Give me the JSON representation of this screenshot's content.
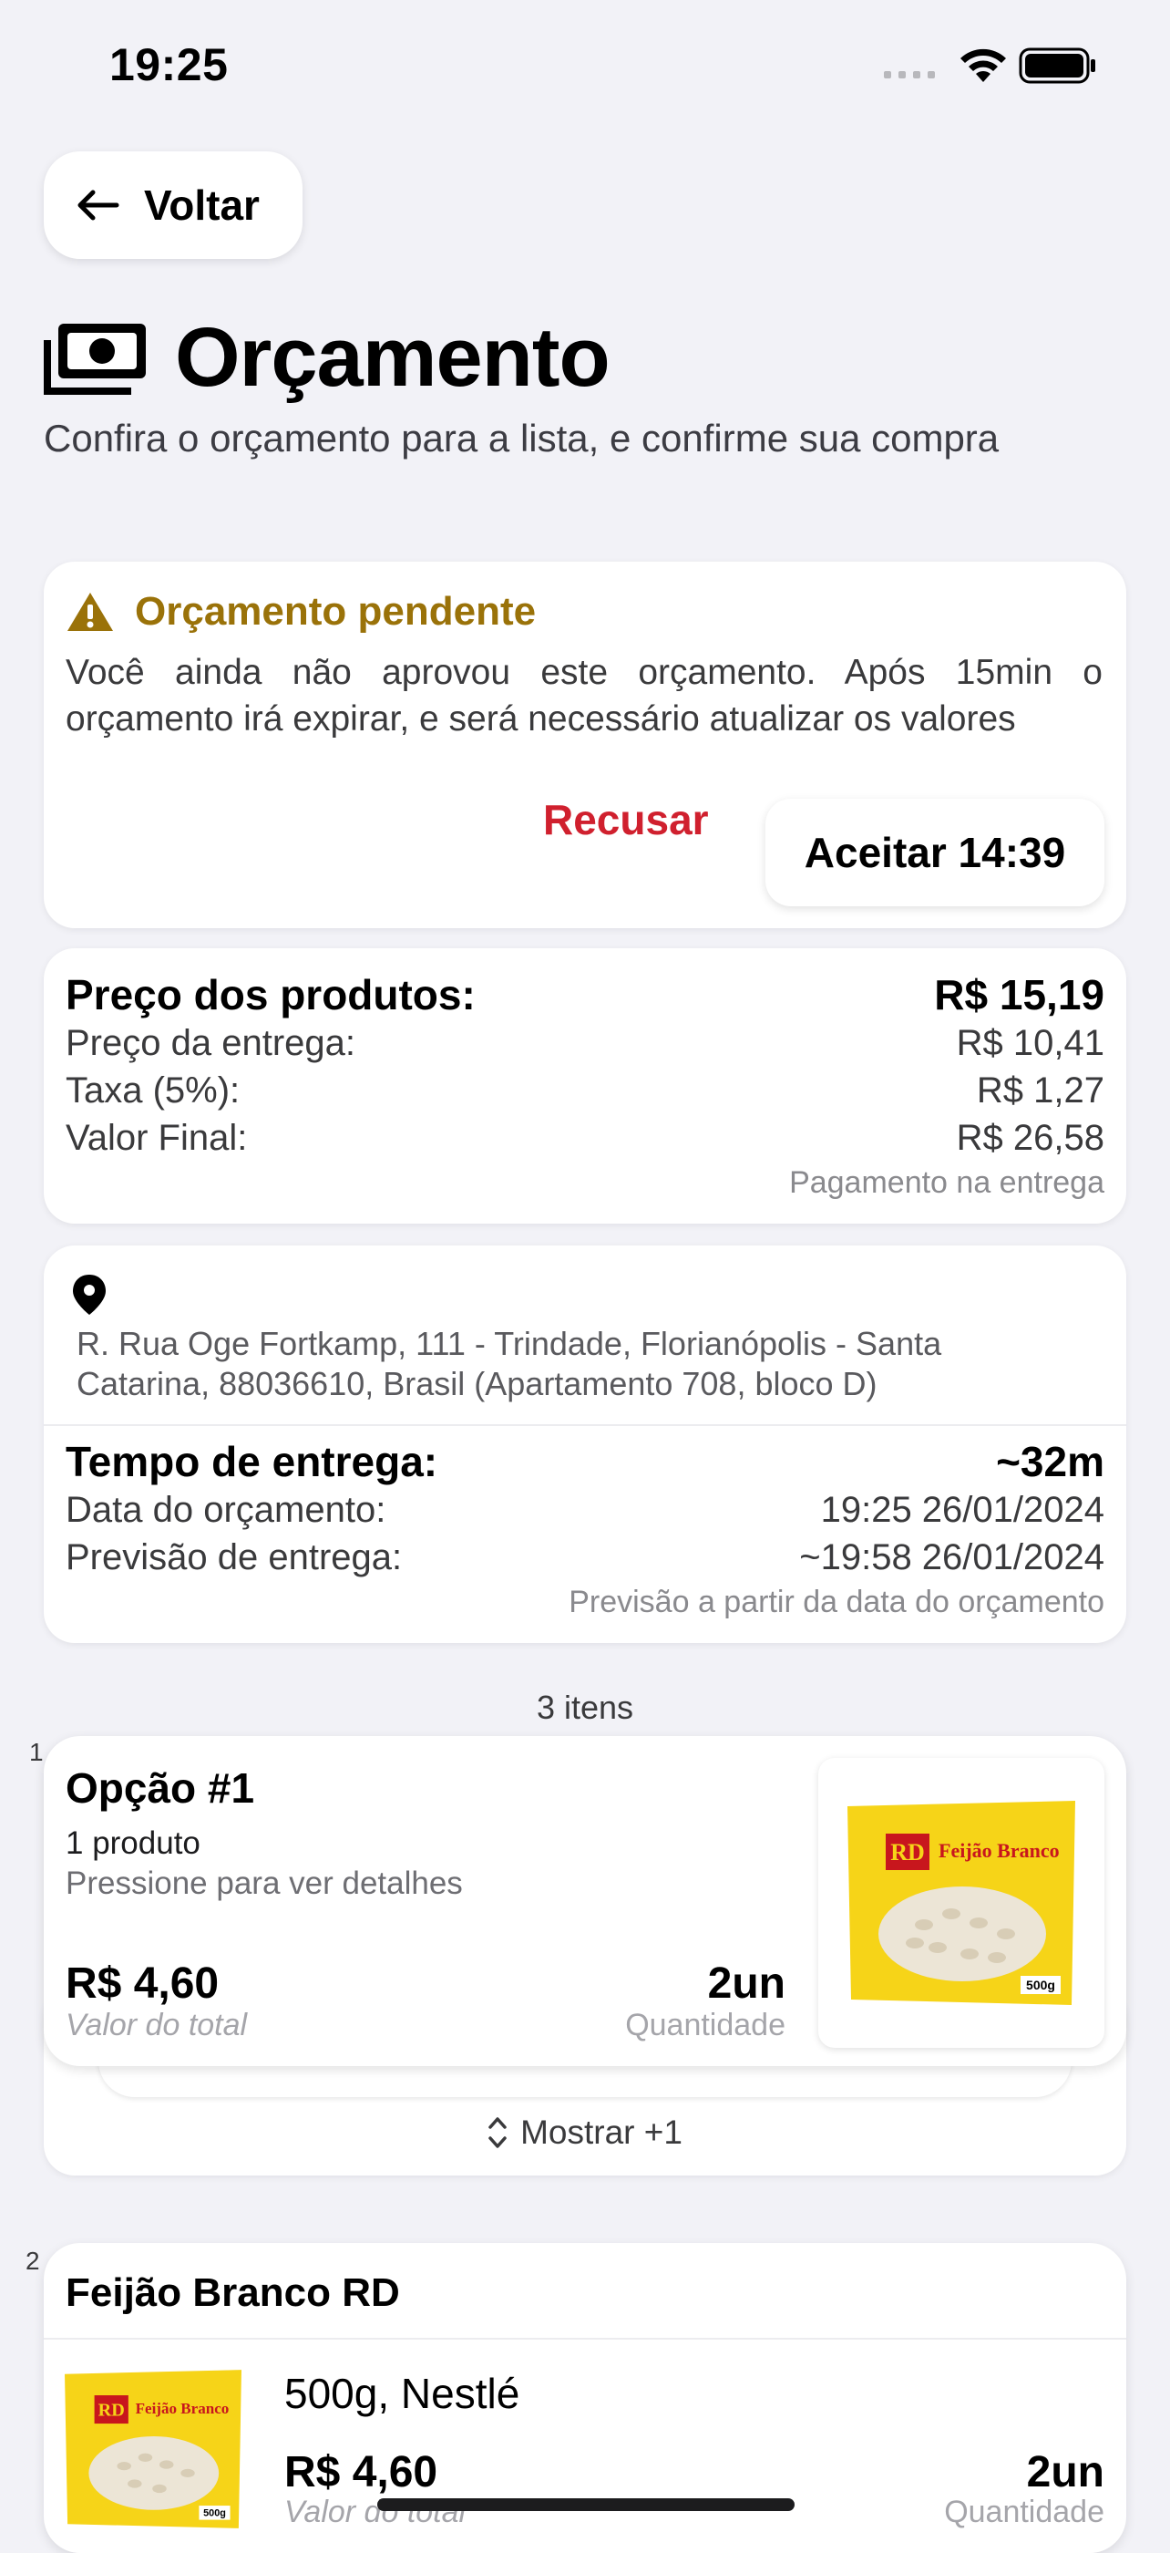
{
  "status_bar": {
    "time": "19:25"
  },
  "nav": {
    "back_label": "Voltar"
  },
  "header": {
    "title": "Orçamento",
    "subtitle": "Confira o orçamento para a lista, e confirme sua compra",
    "icon": "money-icon"
  },
  "pending": {
    "title": "Orçamento pendente",
    "message": "Você ainda não aprovou este orçamento. Após 15min o orçamento irá expirar, e será necessário atualizar os valores",
    "reject_label": "Recusar",
    "accept_label": "Aceitar 14:39",
    "accent_color": "#9a7209",
    "reject_color": "#d0202e"
  },
  "prices": {
    "products_label": "Preço dos produtos:",
    "products_value": "R$ 15,19",
    "delivery_label": "Preço da entrega:",
    "delivery_value": "R$ 10,41",
    "fee_label": "Taxa (5%):",
    "fee_value": "R$ 1,27",
    "final_label": "Valor Final:",
    "final_value": "R$ 26,58",
    "payment_note": "Pagamento na entrega"
  },
  "delivery": {
    "address": "R. Rua Oge Fortkamp, 111 - Trindade, Florianópolis - Santa Catarina, 88036610, Brasil (Apartamento 708, bloco D)",
    "time_label": "Tempo de entrega:",
    "time_value": "~32m",
    "quote_date_label": "Data do orçamento:",
    "quote_date_value": "19:25 26/01/2024",
    "forecast_label": "Previsão de entrega:",
    "forecast_value": "~19:58 26/01/2024",
    "forecast_note": "Previsão a partir da data do orçamento"
  },
  "items": {
    "count_label": "3 itens",
    "list": [
      {
        "index": "1",
        "title": "Opção #1",
        "subtitle": "1 produto",
        "hint": "Pressione para ver detalhes",
        "price": "R$ 4,60",
        "price_label": "Valor do total",
        "quantity": "2un",
        "quantity_label": "Quantidade",
        "show_more_label": "Mostrar +1"
      },
      {
        "index": "2",
        "title": "Feijão Branco RD",
        "variant": "500g, Nestlé",
        "price": "R$ 4,60",
        "price_label": "Valor do total",
        "quantity": "2un",
        "quantity_label": "Quantidade"
      }
    ]
  },
  "product_image": {
    "brand": "RD",
    "name": "Feijão Branco",
    "weight": "500g"
  }
}
